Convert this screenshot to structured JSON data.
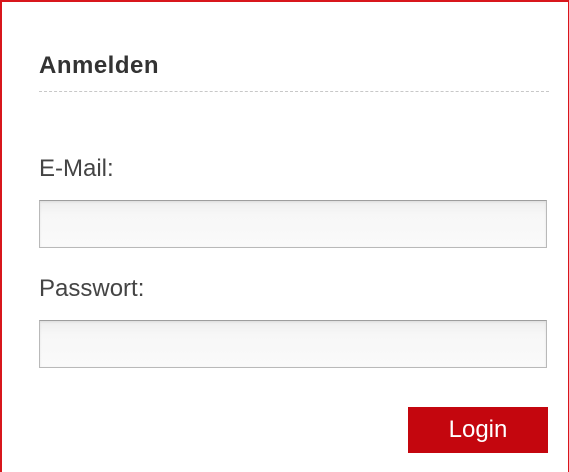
{
  "login_box": {
    "title": "Anmelden",
    "email": {
      "label": "E-Mail:",
      "value": "",
      "placeholder": ""
    },
    "password": {
      "label": "Passwort:",
      "value": "",
      "placeholder": ""
    },
    "submit_label": "Login"
  },
  "colors": {
    "accent": "#c4060e",
    "border": "#d8161c",
    "heading_text": "#333333",
    "label_text": "#444444"
  }
}
